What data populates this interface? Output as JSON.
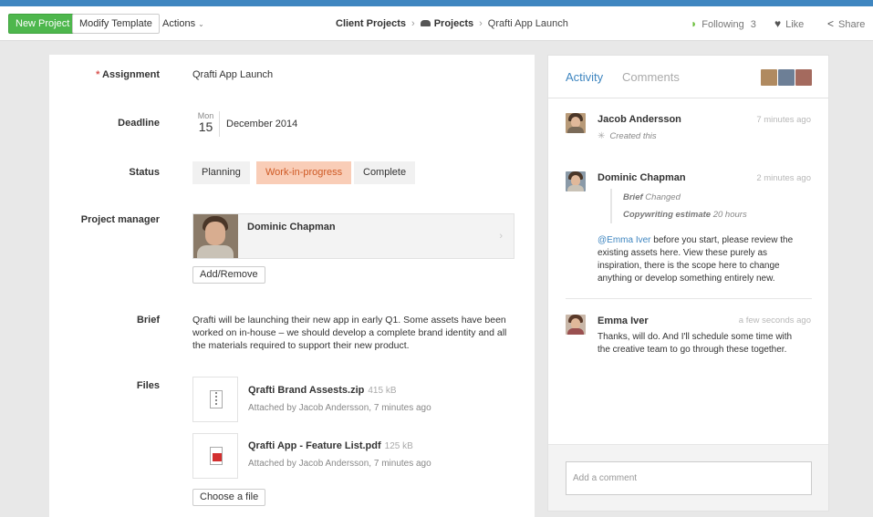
{
  "toolbar": {
    "new_project": "New Project",
    "modify_template": "Modify Template",
    "actions": "Actions",
    "following_label": "Following",
    "following_count": "3",
    "like": "Like",
    "share": "Share"
  },
  "breadcrumb": {
    "client_projects": "Client Projects",
    "projects": "Projects",
    "current": "Qrafti App Launch",
    "separator": "›"
  },
  "form": {
    "assignment_label": "Assignment",
    "required_mark": "*",
    "assignment_value": "Qrafti App Launch",
    "deadline_label": "Deadline",
    "deadline_month": "Mon",
    "deadline_day": "15",
    "deadline_text": "December 2014",
    "status_label": "Status",
    "status_options": [
      "Planning",
      "Work-in-progress",
      "Complete"
    ],
    "status_selected": "Work-in-progress",
    "pm_label": "Project manager",
    "pm_name": "Dominic Chapman",
    "add_remove": "Add/Remove",
    "brief_label": "Brief",
    "brief_text": "Qrafti will be launching their new app in early Q1. Some assets have been worked on in-house – we should develop a complete brand identity and all the materials required to support their new product.",
    "files_label": "Files",
    "files": [
      {
        "name": "Qrafti Brand Assests.zip",
        "size": "415 kB",
        "meta": "Attached by Jacob Andersson, 7 minutes ago",
        "icon": "zip-file-icon"
      },
      {
        "name": "Qrafti App - Feature List.pdf",
        "size": "125 kB",
        "meta": "Attached by Jacob Andersson, 7 minutes ago",
        "icon": "pdf-file-icon"
      }
    ],
    "choose_file": "Choose a file"
  },
  "activity": {
    "tab_activity": "Activity",
    "tab_comments": "Comments",
    "entries": [
      {
        "name": "Jacob Andersson",
        "time": "7 minutes ago",
        "sub": "Created this"
      },
      {
        "name": "Dominic Chapman",
        "time": "2 minutes ago",
        "change1_field": "Brief",
        "change1_value": "Changed",
        "change2_field": "Copywriting estimate",
        "change2_value": "20 hours",
        "mention": "@Emma Iver",
        "text": " before you start, please review the existing assets here. View these purely as inspiration, there is the scope here to change anything or develop something entirely new."
      },
      {
        "name": "Emma Iver",
        "time": "a few seconds ago",
        "text": "Thanks, will do. And I'll schedule some time with the creative team to go through these together."
      }
    ],
    "comment_placeholder": "Add a comment"
  },
  "colors": {
    "brand_blue": "#3f86c0",
    "new_project_green": "#4eb74d",
    "status_active_bg": "#f9cdb7",
    "status_active_text": "#cf5a25",
    "follow_green": "#6cbf3d"
  }
}
